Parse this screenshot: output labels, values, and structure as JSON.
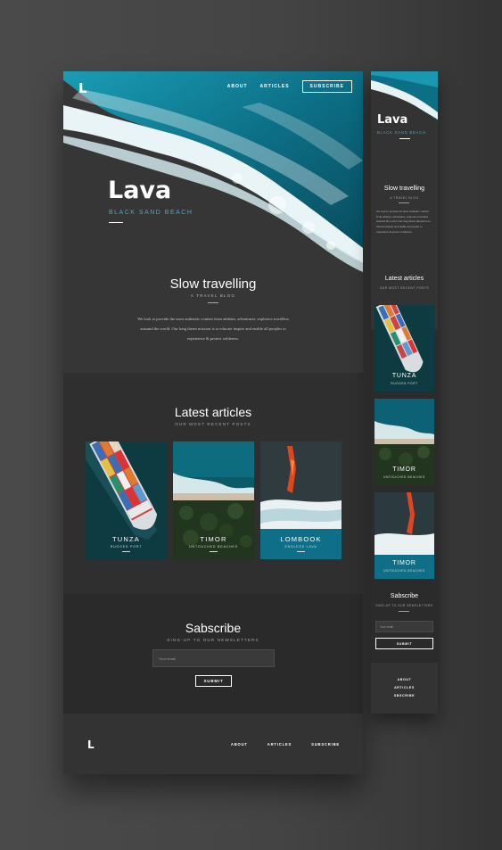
{
  "brand": {
    "logo": "L"
  },
  "nav": {
    "about": "ABOUT",
    "articles": "ARTICLES",
    "subscribe": "SUBSCRIBE"
  },
  "hero": {
    "title": "Lava",
    "subtitle": "BLACK SAND BEACH",
    "section_title": "Slow travelling",
    "section_subtitle": "A TRAVEL BLOG",
    "description": "We look to provide the most authentic content from  athletes, adventures, explorers travellers autsund the world. Our long therm mission is to educate inspire and enable all peoples to experience & protect wilderess."
  },
  "latest": {
    "title": "Latest articles",
    "subtitle": "OUR MOST RECENT POSTS",
    "cards": [
      {
        "title": "TUNZA",
        "subtitle": "RUGGED PORT"
      },
      {
        "title": "TIMOR",
        "subtitle": "UNTOUCHED BEACHES"
      },
      {
        "title": "LOMBOOK",
        "subtitle": "ENDLESS LAVA"
      }
    ]
  },
  "subscribe": {
    "title": "Sabscribe",
    "subtitle": "SING-UP TO OUR NEWSLETTERS",
    "placeholder": "Your email",
    "button": "SUBMIT"
  },
  "footer": {
    "logo": "L",
    "about": "ABOUT",
    "articles": "ARTICLES",
    "subscribe": "SUBSCRIBE"
  },
  "mobile": {
    "title": "Lava",
    "subtitle": "BLACK SAND BEACH",
    "section_title": "Slow travelling",
    "section_subtitle": "A TRAVEL BLOG",
    "description": "We look to provide the most authentic content from  athletes, adventures, explorers travellers autsund the world. Our long therm mission is to educate inspire and enable all peoples to experience & protect wilderess.",
    "latest_title": "Latest articles",
    "latest_subtitle": "OUR MOST RECENT POSTS",
    "cards": [
      {
        "title": "TUNZA",
        "subtitle": "RUGGED PORT"
      },
      {
        "title": "TIMOR",
        "subtitle": "UNTOUCHED BEACHES"
      },
      {
        "title": "TIMOR",
        "subtitle": "UNTOUCHED BEACHES"
      }
    ],
    "subscribe_title": "Sabscribe",
    "subscribe_subtitle": "SING-UP TO OUR NEWSLETTERS",
    "placeholder": "Your email",
    "button": "SUBMIT",
    "footer_nav": [
      "ABOUT",
      "ARTICLES",
      "SBSCRIBE"
    ]
  },
  "colors": {
    "accent": "#4aa8c4",
    "background": "#444444",
    "panel": "#2b2b2b",
    "ocean": "#0e7f96"
  }
}
